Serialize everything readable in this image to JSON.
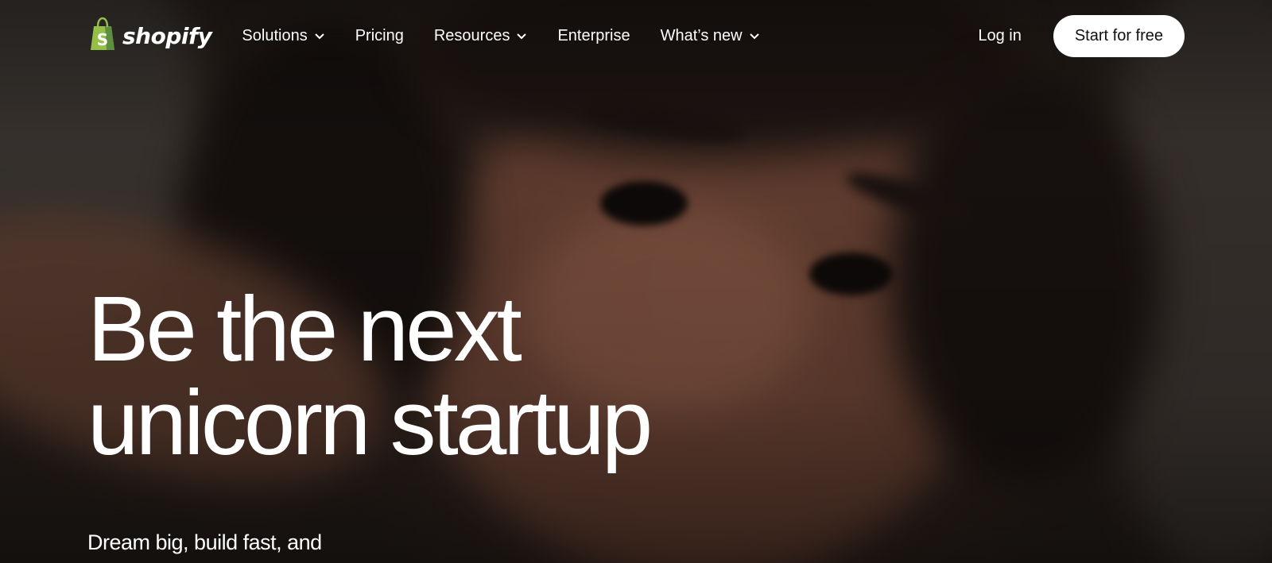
{
  "nav": {
    "logo_text": "shopify",
    "items": [
      {
        "label": "Solutions",
        "dropdown": true
      },
      {
        "label": "Pricing",
        "dropdown": false
      },
      {
        "label": "Resources",
        "dropdown": true
      },
      {
        "label": "Enterprise",
        "dropdown": false
      },
      {
        "label": "What’s new",
        "dropdown": true
      }
    ],
    "login_label": "Log in",
    "cta_label": "Start for free"
  },
  "hero": {
    "headline_line1": "Be the next",
    "headline_line2": "unicorn startup",
    "subtext": "Dream big, build fast, and"
  },
  "colors": {
    "brand_green": "#95bf47",
    "brand_green_dark": "#5e8e3e",
    "text": "#ffffff",
    "cta_bg": "#ffffff",
    "cta_text": "#111111"
  },
  "icons": {
    "logo": "shopping-bag-icon",
    "dropdown": "chevron-down-icon"
  }
}
